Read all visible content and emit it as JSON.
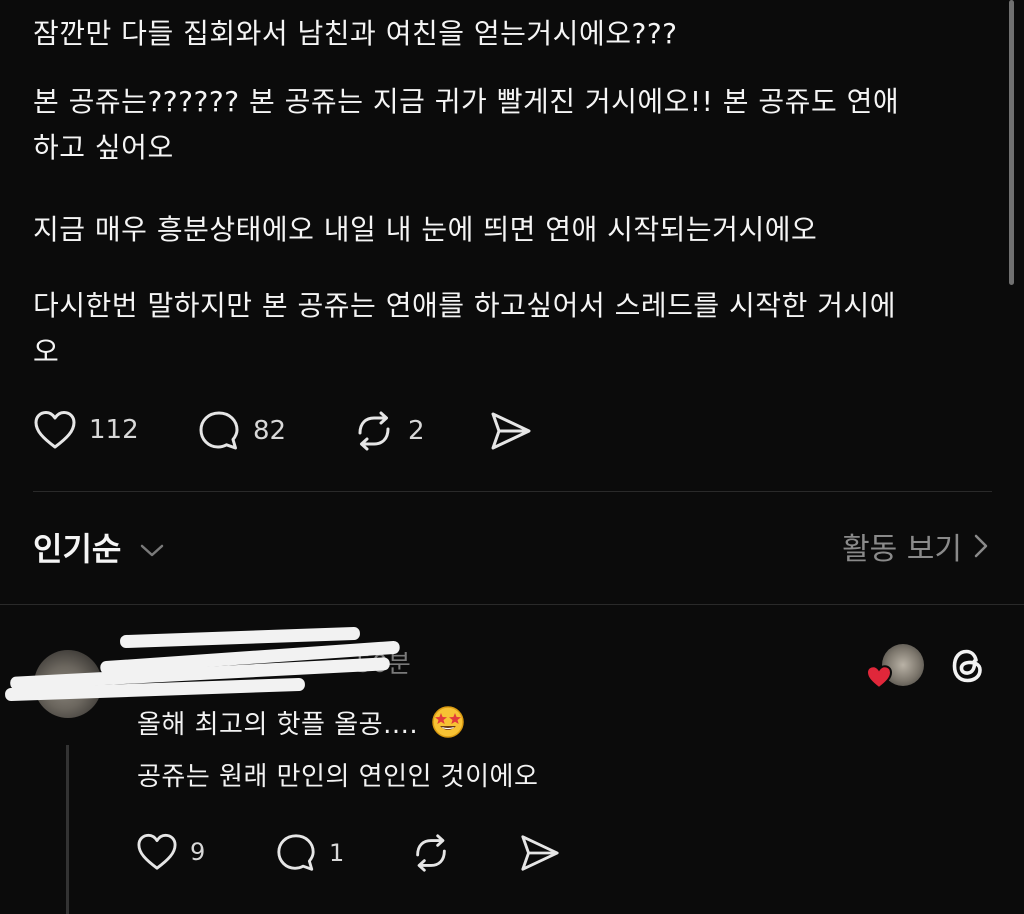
{
  "post": {
    "lines": [
      "잠깐만 다들 집회와서 남친과 여친을 얻는거시에오???",
      "본 공쥬는?????? 본 공쥬는 지금 귀가 빨게진 거시에오!! 본 공쥬도 연애",
      "하고 싶어오",
      "지금 매우 흥분상태에오 내일 내 눈에 띄면 연애 시작되는거시에오",
      "다시한번 말하지만 본 공쥬는 연애를 하고싶어서 스레드를 시작한 거시에",
      "오"
    ],
    "likes": "112",
    "comments": "82",
    "reposts": "2"
  },
  "sort": {
    "label": "인기순",
    "activity_label": "활동 보기"
  },
  "reply": {
    "username": "",
    "time": "50분",
    "line1": "올해 최고의 핫플 올공....",
    "line2": "공쥬는 원래 만인의 연인인 것이에오",
    "likes": "9",
    "comments": "1"
  },
  "colors": {
    "background": "#0b0b0b",
    "text": "#f3f3f3",
    "muted": "#8a8a8a",
    "heart_badge": "#e0273a",
    "emoji": "#f7c234"
  },
  "icons": [
    "heart-icon",
    "comment-icon",
    "repost-icon",
    "share-icon",
    "chevron-down-icon",
    "chevron-right-icon",
    "threads-logo-icon",
    "star-struck-emoji"
  ]
}
